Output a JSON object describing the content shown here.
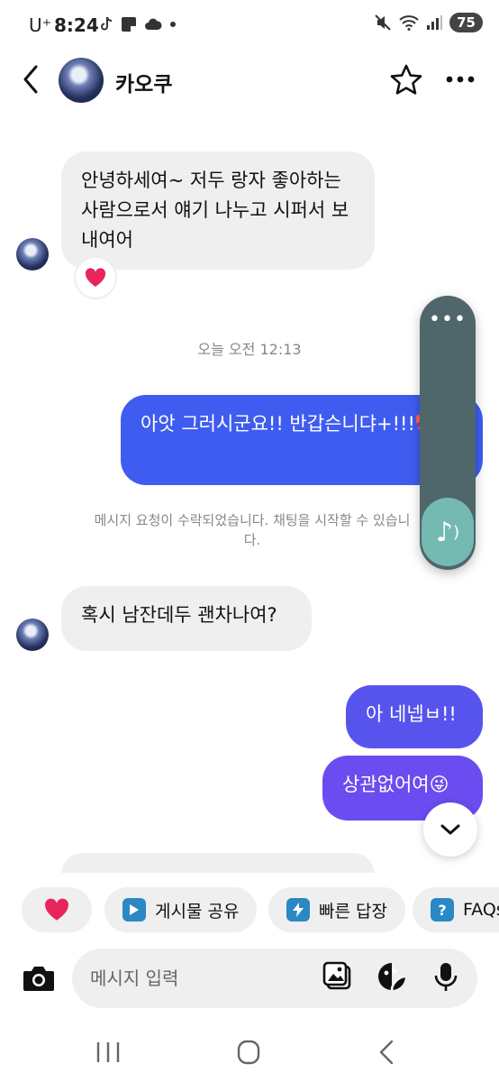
{
  "status_bar": {
    "carrier": "U⁺",
    "time": "8:24",
    "battery": "75"
  },
  "header": {
    "name": "카오쿠"
  },
  "messages": [
    {
      "direction": "in",
      "text": "안녕하세여~ 저두 랑자 좋아하는 사람으로서 얘기 나누고 시퍼서 보내여어",
      "reaction": "heart"
    },
    {
      "direction": "out",
      "text": "아앗 그러시군요!! 반갑슨니댜+!!!🎀🎀"
    },
    {
      "direction": "in",
      "text": "혹시 남잔데두 괜차나여?"
    },
    {
      "direction": "out",
      "text": "아 네넵ㅂ!!"
    },
    {
      "direction": "out",
      "text": "상관없어여😜"
    }
  ],
  "timestamp": "오늘 오전 12:13",
  "system_note": "메시지 요청이 수락되었습니다. 채팅을 시작할 수 있습니다.",
  "music_widget": {
    "menu": "•••",
    "play": "♪"
  },
  "quick_actions": [
    {
      "icon": "heart",
      "label": ""
    },
    {
      "icon": "play-icon",
      "label": "게시물 공유"
    },
    {
      "icon": "bolt-icon",
      "label": "빠른 답장"
    },
    {
      "icon": "question-icon",
      "label": "FAQs"
    }
  ],
  "input": {
    "placeholder": "메시지 입력"
  },
  "colors": {
    "sent_bubble": "#3f5cf0",
    "sent_bubble_alt": "#6b4cf0",
    "received_bubble": "#efefef",
    "music_widget": "#4f666b",
    "music_play": "#74b9b2"
  }
}
